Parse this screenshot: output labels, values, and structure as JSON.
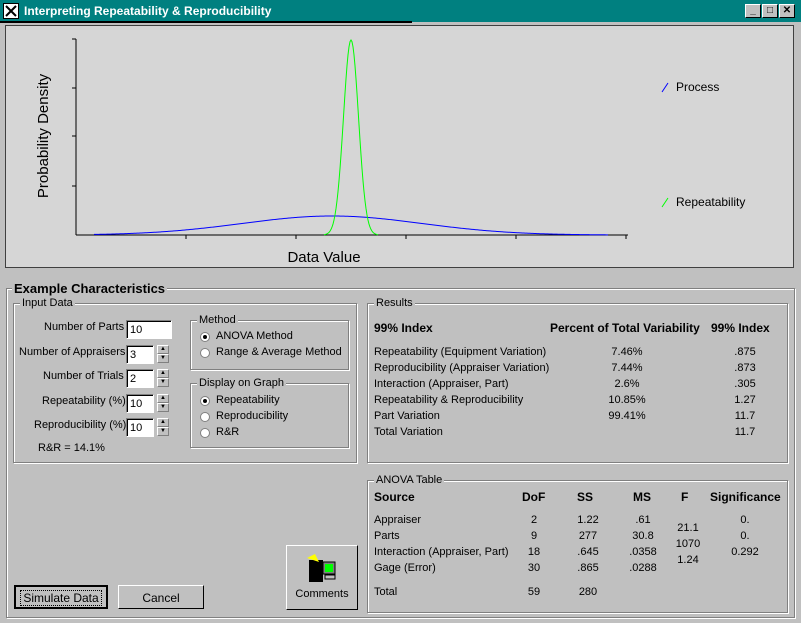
{
  "window": {
    "title": "Interpreting Repeatability & Reproducibility"
  },
  "graph": {
    "ylabel": "Probability Density",
    "xlabel": "Data Value",
    "legend": [
      {
        "name": "Process",
        "color": "#0000ff"
      },
      {
        "name": "Repeatability",
        "color": "#00ff00"
      }
    ]
  },
  "section_title": "Example Characteristics",
  "input": {
    "label": "Input Data",
    "parts_label": "Number of Parts",
    "parts": "10",
    "appraisers_label": "Number of Appraisers",
    "appraisers": "3",
    "trials_label": "Number of Trials",
    "trials": "2",
    "repeat_label": "Repeatability (%)",
    "repeat": "10",
    "reprod_label": "Reproducibility (%)",
    "reprod": "10",
    "rr": "R&R = 14.1%"
  },
  "method": {
    "label": "Method",
    "options": [
      "ANOVA Method",
      "Range & Average Method"
    ],
    "selected": 0
  },
  "display": {
    "label": "Display on Graph",
    "options": [
      "Repeatability",
      "Reproducibility",
      "R&R"
    ],
    "selected": 0
  },
  "results": {
    "label": "Results",
    "headers": [
      "99% Index",
      "Percent of Total Variability",
      "99% Index"
    ],
    "rows": [
      [
        "Repeatability (Equipment Variation)",
        "7.46%",
        ".875"
      ],
      [
        "Reproducibility (Appraiser Variation)",
        "7.44%",
        ".873"
      ],
      [
        "Interaction (Appraiser, Part)",
        "2.6%",
        ".305"
      ],
      [
        "Repeatability & Reproducibility",
        "10.85%",
        "1.27"
      ],
      [
        "Part Variation",
        "99.41%",
        "11.7"
      ],
      [
        "Total Variation",
        "",
        "11.7"
      ]
    ]
  },
  "anova": {
    "label": "ANOVA Table",
    "headers": [
      "Source",
      "DoF",
      "SS",
      "MS",
      "F",
      "Significance"
    ],
    "rows": [
      [
        "Appraiser",
        "2",
        "1.22",
        ".61"
      ],
      [
        "Parts",
        "9",
        "277",
        "30.8"
      ],
      [
        "Interaction (Appraiser, Part)",
        "18",
        ".645",
        ".0358"
      ],
      [
        "Gage (Error)",
        "30",
        ".865",
        ".0288"
      ]
    ],
    "f_values": [
      "21.1",
      "1070",
      "1.24"
    ],
    "significance": [
      "0.",
      "0.",
      "0.292"
    ],
    "total": [
      "Total",
      "59",
      "280"
    ]
  },
  "buttons": {
    "simulate": "Simulate Data",
    "cancel": "Cancel",
    "comments": "Comments"
  }
}
